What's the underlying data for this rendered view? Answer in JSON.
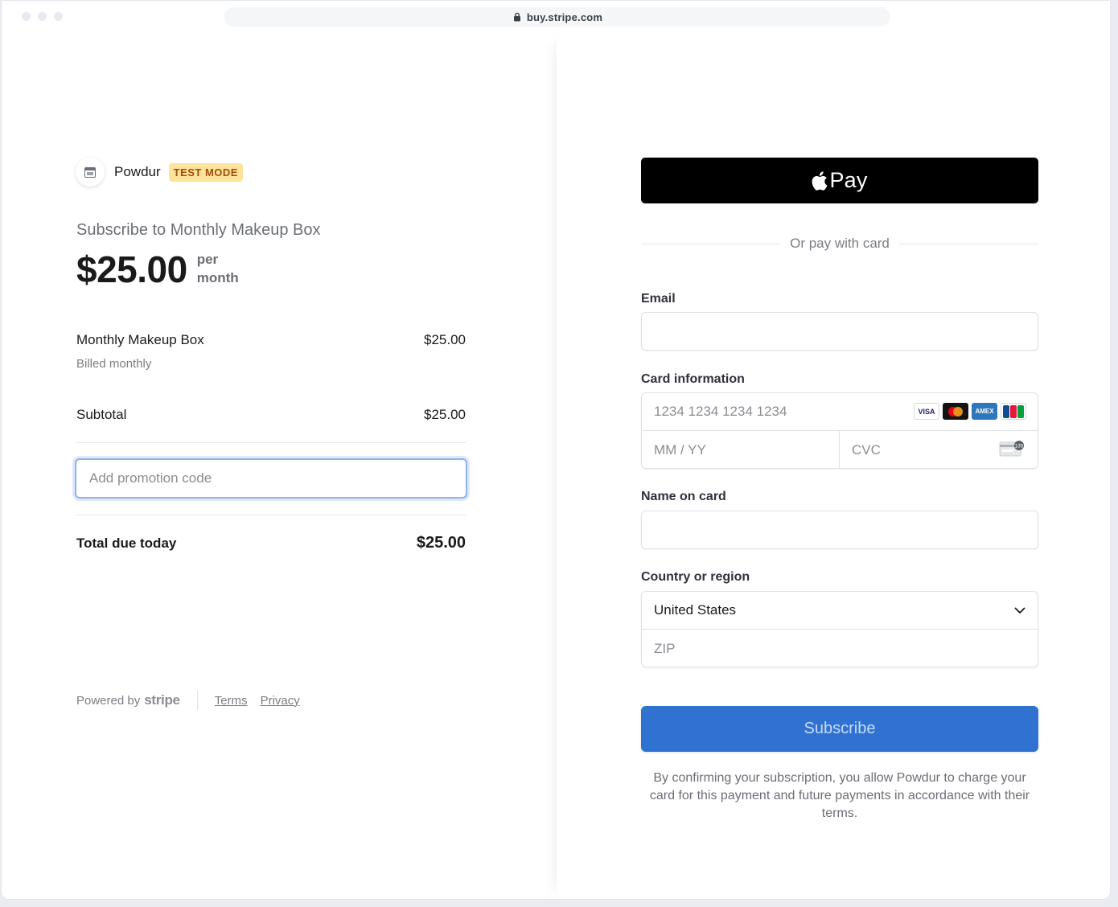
{
  "browser": {
    "url": "buy.stripe.com",
    "traffic_light_color": "#e8ebef"
  },
  "merchant": {
    "name": "Powdur",
    "badge": "TEST MODE",
    "icon": "storefront-icon"
  },
  "summary": {
    "title": "Subscribe to Monthly Makeup Box",
    "price": "$25.00",
    "period_line1": "per",
    "period_line2": "month",
    "line_item": {
      "name": "Monthly Makeup Box",
      "price": "$25.00",
      "billing": "Billed monthly"
    },
    "subtotal_label": "Subtotal",
    "subtotal_value": "$25.00",
    "promo_placeholder": "Add promotion code",
    "total_label": "Total due today",
    "total_value": "$25.00"
  },
  "footer": {
    "powered_by": "Powered by",
    "brand": "stripe",
    "links": [
      "Terms",
      "Privacy"
    ]
  },
  "payment": {
    "apple_pay_label": "Pay",
    "divider_text": "Or pay with card",
    "email_label": "Email",
    "email_value": "",
    "card_label": "Card information",
    "card_number_placeholder": "1234 1234 1234 1234",
    "card_brands": [
      "VISA",
      "mastercard",
      "AMEX",
      "JCB"
    ],
    "expiry_placeholder": "MM / YY",
    "cvc_placeholder": "CVC",
    "cvc_icon_text": "135",
    "name_label": "Name on card",
    "name_value": "",
    "country_label": "Country or region",
    "country_value": "United States",
    "zip_placeholder": "ZIP",
    "submit_label": "Subscribe",
    "disclaimer": "By confirming your subscription, you allow Powdur to charge your card for this payment and future payments in accordance with their terms."
  },
  "colors": {
    "accent": "#3072d0",
    "test_mode_bg": "#fde49a",
    "test_mode_text": "#a04d0b",
    "apple_pay_bg": "#000000"
  }
}
